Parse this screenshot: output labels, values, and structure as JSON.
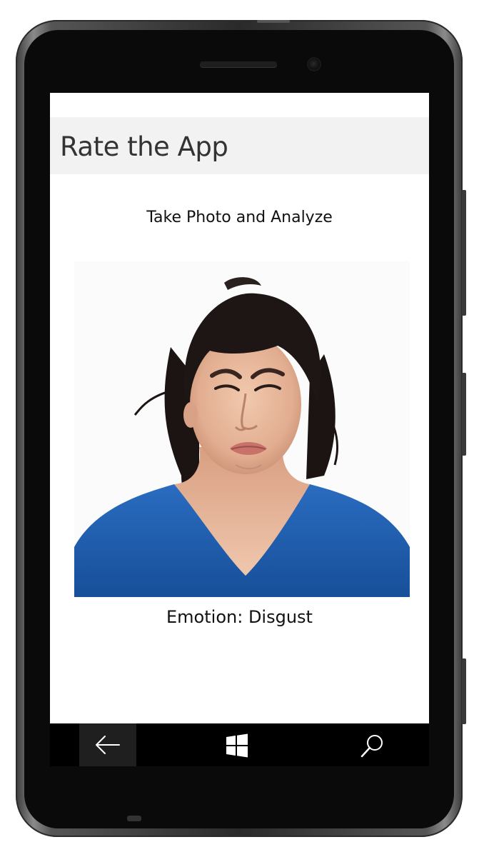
{
  "app": {
    "title": "Rate the App"
  },
  "main": {
    "take_photo_label": "Take Photo and Analyze",
    "photo_alt": "Photo of a woman with a disgusted facial expression",
    "result_label": "Emotion:",
    "result_value": "Disgust"
  },
  "navbar": {
    "back_icon": "back-arrow-icon",
    "start_icon": "windows-logo-icon",
    "search_icon": "search-icon"
  },
  "colors": {
    "title_bar": "#f2f2f2",
    "shirt_blue": "#1f5fb0",
    "nav_background": "#000000"
  }
}
